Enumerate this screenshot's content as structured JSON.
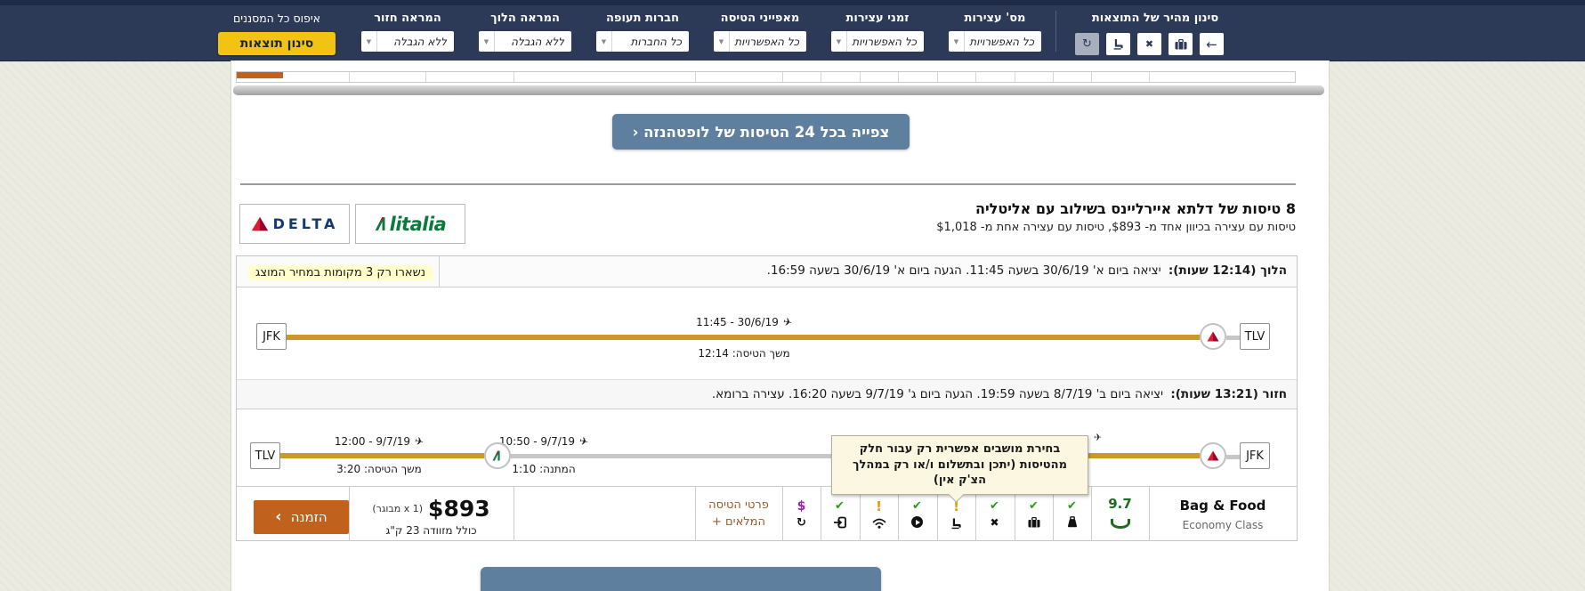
{
  "header": {
    "quick_filter_title": "סינון מהיר של התוצאות",
    "quick_buttons": [
      "refresh-icon",
      "seat-icon",
      "close-icon",
      "briefcase-icon",
      "back-arrow-icon"
    ],
    "groups": [
      {
        "label": "מס' עצירות",
        "value": "כל האפשרויות"
      },
      {
        "label": "זמני עצירות",
        "value": "כל האפשרויות"
      },
      {
        "label": "מאפייני הטיסה",
        "value": "כל האפשרויות"
      },
      {
        "label": "חברות תעופה",
        "value": "כל החברות"
      },
      {
        "label": "המראה הלוך",
        "value": "ללא הגבלה"
      },
      {
        "label": "המראה חזור",
        "value": "ללא הגבלה"
      }
    ],
    "reset_all_label": "איפוס כל המסננים",
    "filter_results_button": "סינון תוצאות",
    "colors": {
      "bar": "#2c3a57",
      "accent_yellow": "#f2c313"
    }
  },
  "view_all_top_button": "צפייה בכל 24 הטיסות של לופטהנזה ‹",
  "airline_group": {
    "title": "8 טיסות של דלתא איירליינס בשילוב עם אליטליה",
    "subtitle": "טיסות עם עצירה בכיוון אחד מ- $893, טיסות עם עצירה אחת מ- $1,018",
    "logo_delta_text": "DELTA",
    "logo_alitalia_tail": "litalia"
  },
  "card": {
    "seats_note": "נשארו רק 3 מקומות במחיר המוצג",
    "outbound": {
      "label": "הלוך (12:14 שעות):",
      "details": "יציאה ביום א' 30/6/19 בשעה 11:45. הגעה ביום א' 30/6/19 בשעה 16:59.",
      "origin": "JFK",
      "destination": "TLV",
      "segment_time": "11:45 - 30/6/19",
      "duration": "משך הטיסה: 12:14"
    },
    "inbound": {
      "label": "חזור (13:21 שעות):",
      "details": "יציאה ביום ב' 8/7/19 בשעה 19:59. הגעה ביום ג' 9/7/19 בשעה 16:20. עצירה ברומא.",
      "origin": "TLV",
      "destination": "JFK",
      "segment1_time": "12:00 - 9/7/19",
      "segment1_duration": "משך הטיסה: 3:20",
      "segment2_time": "10:50 - 9/7/19",
      "segment2_wait": "המתנה: 1:10"
    },
    "tooltip": "בחירת מושבים אפשרית רק עבור חלק מהטיסות (יתכן ובתשלום ו/או רק במהלך הצ'ק אין)",
    "summary": {
      "order_button": "הזמנה",
      "order_chevron": "‹",
      "price": "$893",
      "pax_note": "(1 x מבוגר)",
      "baggage_note": "כולל מזוודה 23 ק\"ג",
      "details_link_line1": "פרטי הטיסה",
      "details_link_line2": "המלאים +",
      "features": [
        {
          "mark": "$",
          "status": "paid",
          "icon": "refund-refresh-icon"
        },
        {
          "mark": "✔",
          "status": "ok",
          "icon": "check-in-icon"
        },
        {
          "mark": "!",
          "status": "warn",
          "icon": "wifi-icon"
        },
        {
          "mark": "✔",
          "status": "ok",
          "icon": "entertainment-play-icon"
        },
        {
          "mark": "!",
          "status": "warn",
          "icon": "seat-selection-icon"
        },
        {
          "mark": "✔",
          "status": "ok",
          "icon": "meal-icon"
        },
        {
          "mark": "✔",
          "status": "ok",
          "icon": "cabin-bag-icon"
        },
        {
          "mark": "✔",
          "status": "ok",
          "icon": "baggage-weight-icon"
        }
      ],
      "rating": "9.7",
      "fare_name": "Bag & Food",
      "fare_class": "Economy Class"
    }
  }
}
